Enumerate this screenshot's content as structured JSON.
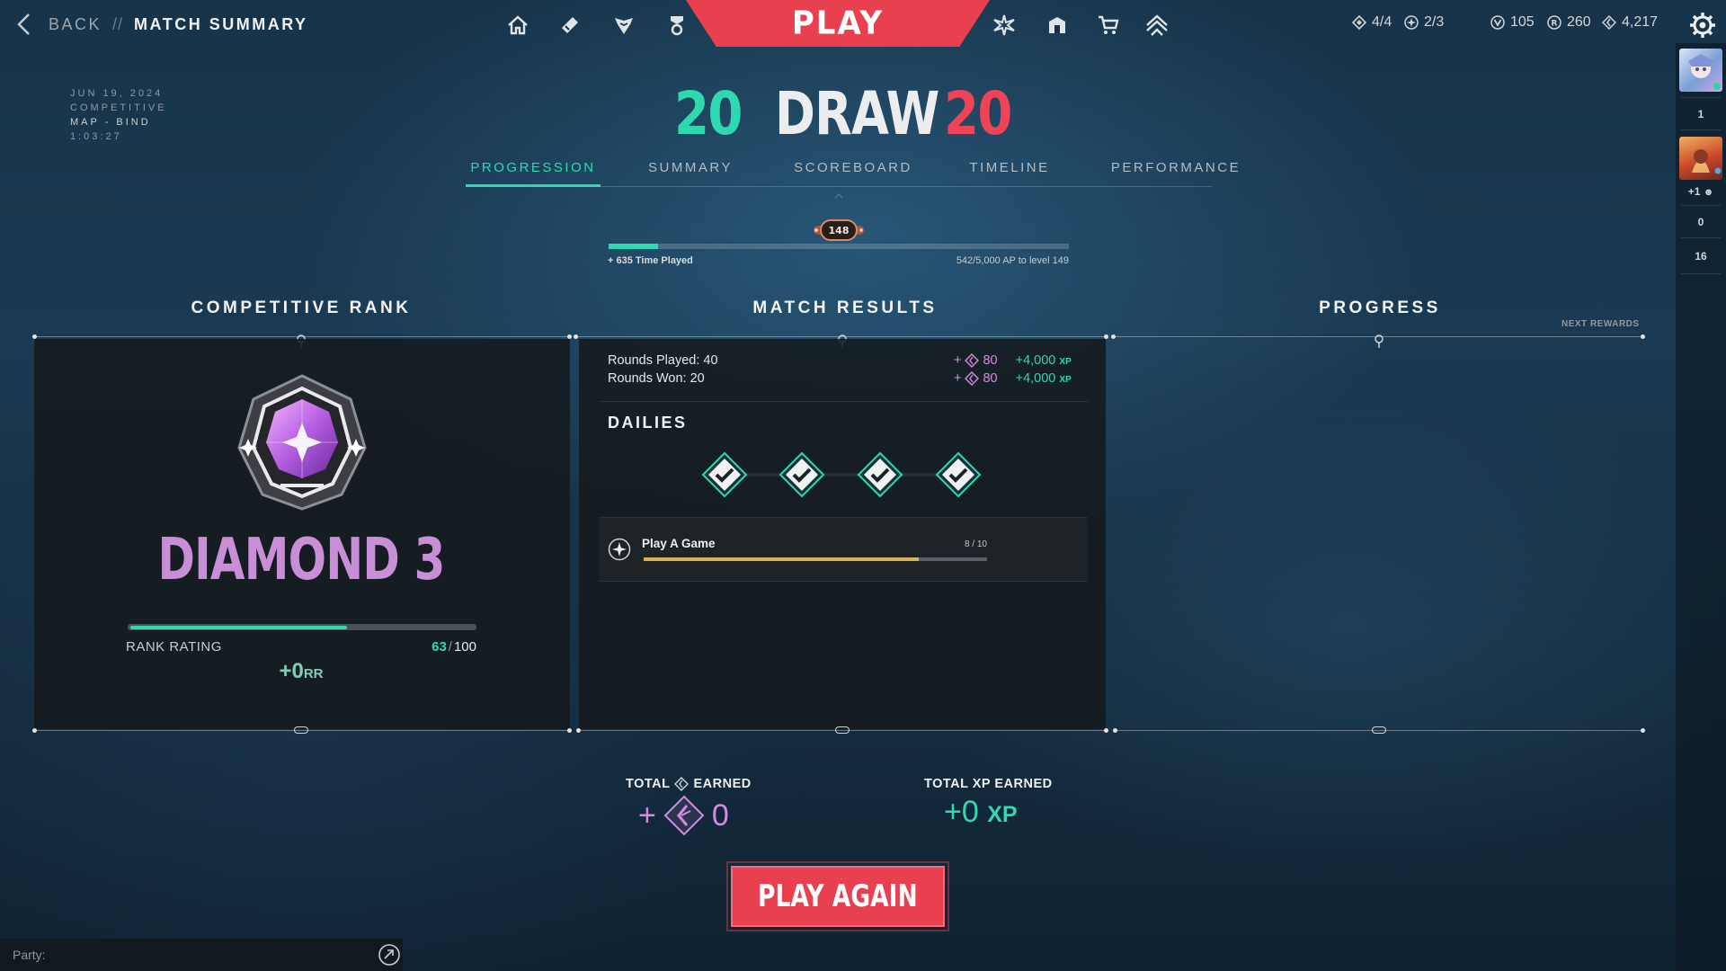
{
  "header": {
    "back_label": "BACK",
    "separator": "//",
    "title": "MATCH SUMMARY",
    "play_label": "PLAY",
    "nav_icons": [
      "home-icon",
      "collection-icon",
      "agents-icon",
      "career-icon",
      "battlepass-icon",
      "barracks-icon",
      "store-icon",
      "rank-icon"
    ],
    "currencies": [
      {
        "icon": "dailies-icon",
        "value": "4/4"
      },
      {
        "icon": "weekly-icon",
        "value": "2/3"
      },
      {
        "icon": "vp-icon",
        "value": "105"
      },
      {
        "icon": "radianite-icon",
        "value": "260"
      },
      {
        "icon": "kingdom-credits-icon",
        "value": "4,217"
      }
    ]
  },
  "party_strip": {
    "counts": [
      "1",
      "+1",
      "0",
      "16"
    ]
  },
  "match": {
    "date": "JUN 19, 2024",
    "mode": "COMPETITIVE",
    "map": "MAP - BIND",
    "duration": "1:03:27",
    "score_left": "20",
    "result": "DRAW",
    "score_right": "20"
  },
  "tabs": [
    "PROGRESSION",
    "SUMMARY",
    "SCOREBOARD",
    "TIMELINE",
    "PERFORMANCE"
  ],
  "active_tab": 0,
  "level": {
    "current": "148",
    "progress": 0.108,
    "left_text": "+ 635 Time Played",
    "right_text": "542/5,000 AP to level 149"
  },
  "sections": {
    "rank_title": "COMPETITIVE RANK",
    "results_title": "MATCH RESULTS",
    "progress_title": "PROGRESS",
    "next_rewards": "NEXT REWARDS"
  },
  "rank": {
    "name": "DIAMOND 3",
    "rr_label": "RANK RATING",
    "rr_value": "63",
    "rr_sep": "/",
    "rr_max": "100",
    "rr_progress": 0.63,
    "rr_gain": "+0",
    "rr_unit": "RR"
  },
  "results": {
    "rows": [
      {
        "label": "Rounds Played: 40",
        "kc_prefix": "+",
        "kc": "80",
        "xp": "+4,000",
        "xp_unit": "XP"
      },
      {
        "label": "Rounds Won: 20",
        "kc_prefix": "+",
        "kc": "80",
        "xp": "+4,000",
        "xp_unit": "XP"
      }
    ],
    "dailies_title": "DAILIES",
    "dailies_completed": 4,
    "mission": {
      "name": "Play A Game",
      "count": "8 / 10",
      "progress": 0.8
    }
  },
  "totals": {
    "kc_label_before": "TOTAL",
    "kc_label_after": "EARNED",
    "kc_prefix": "+",
    "kc_value": "0",
    "xp_label": "TOTAL XP EARNED",
    "xp_value": "+0",
    "xp_unit": "XP"
  },
  "play_again_label": "PLAY AGAIN",
  "party_label": "Party:",
  "colors": {
    "accent_green": "#2fd9b0",
    "accent_red": "#e8404e",
    "rank_purple": "#c98fd6",
    "kingdom_pink": "#d58be2"
  }
}
